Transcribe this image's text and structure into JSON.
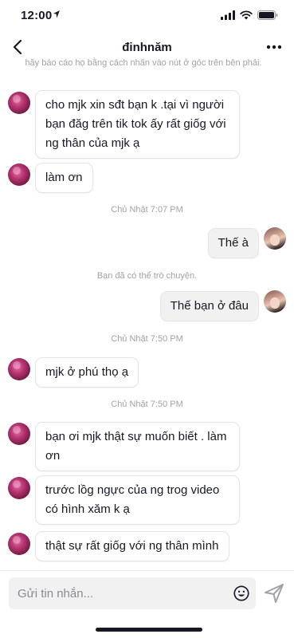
{
  "status_bar": {
    "time": "12:00"
  },
  "header": {
    "title": "đinhnăm"
  },
  "notice": {
    "text": "hãy báo cáo họ bằng cách nhấn vào nút ở góc trên bên phải."
  },
  "messages": [
    {
      "sender": "other",
      "text": "cho mjk xin sđt bạn k .tại vì người bạn đăg trên tik tok ấy rất giốg với ng thân của mjk ạ"
    },
    {
      "sender": "other",
      "text": "làm ơn"
    },
    {
      "sender": "self",
      "text": "Thế à"
    },
    {
      "sender": "self",
      "text": "Thế bạn ở đâu"
    },
    {
      "sender": "other",
      "text": "mjk ở phú thọ ạ"
    },
    {
      "sender": "other",
      "text": "bạn ơi mjk thật sự muốn biết . làm ơn"
    },
    {
      "sender": "other",
      "text": "trước lồg ngực của ng trog video có hình xăm k ạ"
    },
    {
      "sender": "other",
      "text": "thật sự rất giốg với ng thân mình"
    }
  ],
  "timestamps": [
    "Chủ Nhật 7:07 PM",
    "Chủ Nhật 7:50 PM",
    "Chủ Nhật 7:50 PM"
  ],
  "system_notice": "Bạn đã có thể trò chuyện.",
  "composer": {
    "placeholder": "Gửi tin nhắn..."
  },
  "icons": {
    "back": "chevron-left-icon",
    "more": "more-horizontal-icon",
    "emoji": "smiley-icon",
    "send": "send-icon",
    "location": "location-arrow-icon",
    "signal": "signal-bars-icon",
    "wifi": "wifi-icon",
    "battery": "battery-icon"
  },
  "colors": {
    "text": "#161823",
    "muted": "#a1a2a7",
    "self_bubble": "#f1f1f2",
    "other_bubble": "#ffffff",
    "border": "#e3e3e4"
  }
}
